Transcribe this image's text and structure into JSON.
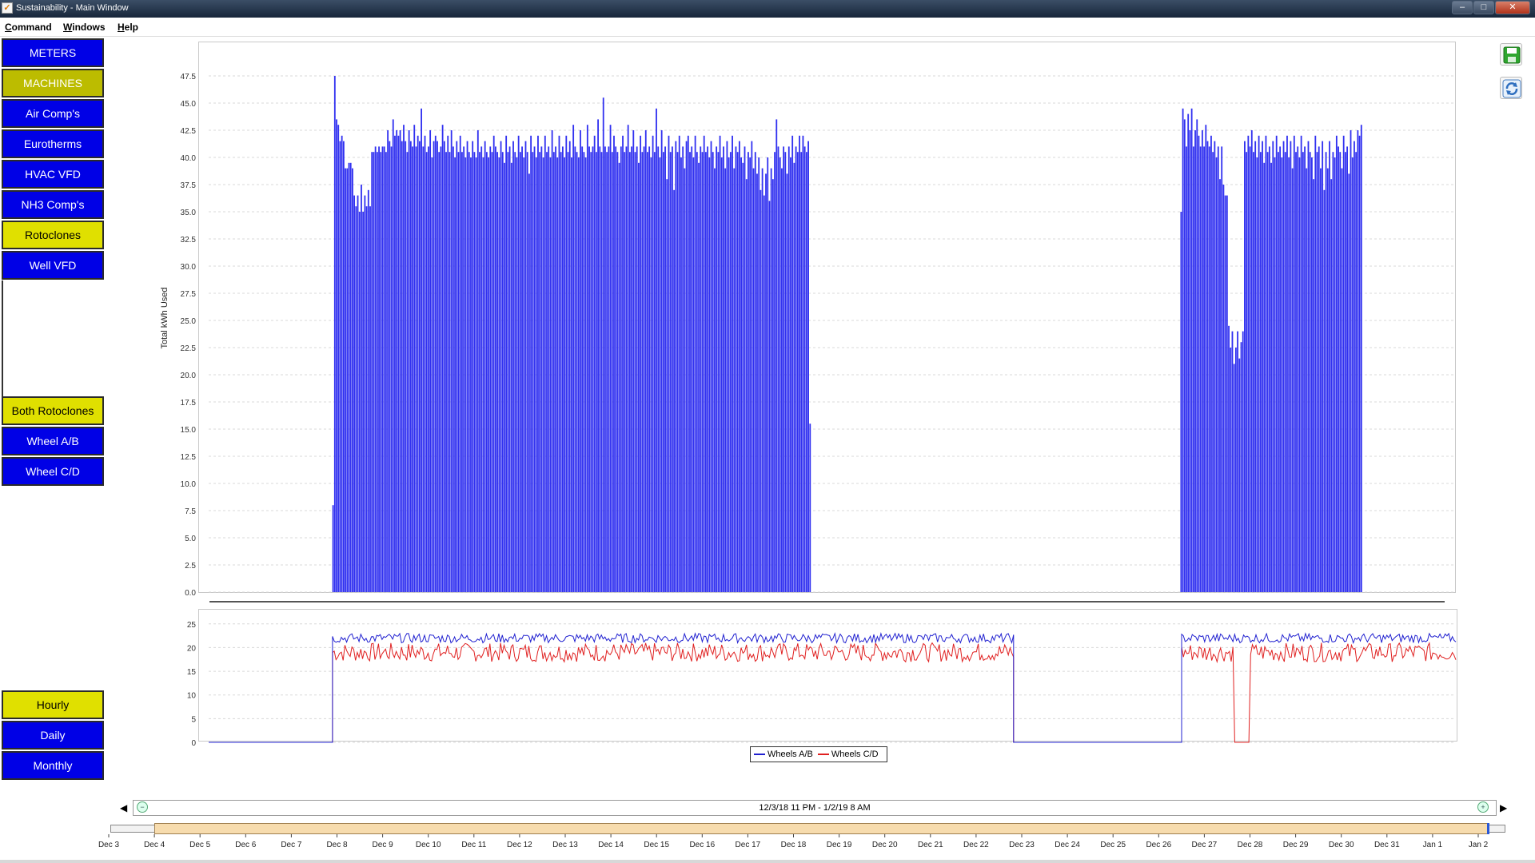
{
  "window": {
    "title": "Sustainability - Main Window",
    "icon": "check-icon",
    "min": "–",
    "max": "□",
    "close": "✕"
  },
  "menu": [
    {
      "label": "Command",
      "mnemonic": "C",
      "rest": "ommand"
    },
    {
      "label": "Windows",
      "mnemonic": "W",
      "rest": "indows"
    },
    {
      "label": "Help",
      "mnemonic": "H",
      "rest": "elp"
    }
  ],
  "sidebar": {
    "top": [
      {
        "label": "METERS",
        "style": "blue"
      },
      {
        "label": "MACHINES",
        "style": "olive"
      },
      {
        "label": "Air Comp's",
        "style": "blue"
      },
      {
        "label": "Eurotherms",
        "style": "blue"
      },
      {
        "label": "HVAC VFD",
        "style": "blue"
      },
      {
        "label": "NH3 Comp's",
        "style": "blue"
      },
      {
        "label": "Rotoclones",
        "style": "yellow"
      },
      {
        "label": "Well VFD",
        "style": "blue"
      }
    ],
    "middle": [
      {
        "label": "Both Rotoclones",
        "style": "yellow"
      },
      {
        "label": "Wheel A/B",
        "style": "blue"
      },
      {
        "label": "Wheel C/D",
        "style": "blue"
      }
    ],
    "bottom": [
      {
        "label": "Hourly",
        "style": "yellow"
      },
      {
        "label": "Daily",
        "style": "blue"
      },
      {
        "label": "Monthly",
        "style": "blue"
      }
    ]
  },
  "toolbar_icons": [
    "save-icon",
    "refresh-icon"
  ],
  "time_range": {
    "label": "12/3/18 11 PM - 1/2/19 8 AM",
    "left_arrow": "◀",
    "right_arrow": "▶",
    "zoom_out": "−",
    "zoom_in": "+"
  },
  "date_ticks": [
    "Dec 3",
    "Dec 4",
    "Dec 5",
    "Dec 6",
    "Dec 7",
    "Dec 8",
    "Dec 9",
    "Dec 10",
    "Dec 11",
    "Dec 12",
    "Dec 13",
    "Dec 14",
    "Dec 15",
    "Dec 16",
    "Dec 17",
    "Dec 18",
    "Dec 19",
    "Dec 20",
    "Dec 21",
    "Dec 22",
    "Dec 23",
    "Dec 24",
    "Dec 25",
    "Dec 26",
    "Dec 27",
    "Dec 28",
    "Dec 29",
    "Dec 30",
    "Dec 31",
    "Jan 1",
    "Jan 2"
  ],
  "legend": [
    {
      "label": "Wheels A/B",
      "color": "#2020d0"
    },
    {
      "label": "Wheels C/D",
      "color": "#e02020"
    }
  ],
  "chart_data": [
    {
      "type": "bar",
      "ylabel": "Total kWh Used",
      "ylim": [
        0,
        50
      ],
      "yticks": [
        "0.0",
        "2.5",
        "5.0",
        "7.5",
        "10.0",
        "12.5",
        "15.0",
        "17.5",
        "20.0",
        "22.5",
        "25.0",
        "27.5",
        "30.0",
        "32.5",
        "35.0",
        "37.5",
        "40.0",
        "42.5",
        "45.0",
        "47.5"
      ],
      "xlim": [
        "12/3/18 11 PM",
        "1/2/19 8 AM"
      ],
      "grid": true,
      "color": "#3030f0",
      "series": [
        {
          "segments": [
            {
              "start": "12/6/18 9 PM",
              "values": [
                8,
                47.5,
                43.5,
                43,
                41.5,
                42,
                41.5,
                39,
                39,
                39.5,
                39.5,
                39,
                36.5,
                35.5,
                36.5,
                35,
                37.5,
                35,
                36.5,
                35.5,
                37,
                35.5,
                40.5,
                40.5,
                41,
                40.5,
                41,
                40.5,
                41,
                41,
                40.5,
                42.5,
                41.5,
                41,
                43.5,
                42,
                42.5,
                42,
                42.5,
                41.5,
                43,
                41.5,
                40.5,
                42.5,
                41.5,
                41,
                43,
                41,
                42,
                41.5,
                44.5,
                41,
                42,
                40.5,
                41,
                42.5,
                40,
                41.5,
                42,
                41.5,
                40.5,
                41,
                43,
                41.5,
                40.5,
                42,
                40.5,
                42.5,
                41,
                40,
                41.5,
                40.5,
                42,
                40.5,
                41,
                40,
                41.5,
                40.5,
                40,
                41.5,
                40.5,
                40,
                42.5,
                40.5,
                41,
                40,
                41.5,
                40.5,
                40,
                41,
                40.5,
                42,
                41,
                40.5,
                40,
                41.5,
                40.5,
                39.5,
                42,
                40.5,
                41,
                39.5,
                41.5,
                40.5,
                40,
                42,
                40.5,
                41,
                40,
                41.5,
                40.5,
                38.5,
                42,
                40.5,
                41,
                40,
                42,
                40.5,
                41,
                40,
                42,
                40.5,
                41,
                40,
                42.5,
                40.5,
                41,
                40,
                42,
                40.5,
                41,
                40,
                42,
                40.5,
                41.5,
                40,
                43,
                41,
                40.5,
                40,
                42.5,
                41,
                40.5,
                40,
                43,
                41,
                40.5,
                41,
                42,
                40.5,
                43.5,
                41,
                40.5,
                45.5,
                41,
                40.5,
                41,
                43,
                40.5,
                42,
                41,
                40.5,
                39.5,
                41,
                42,
                40.5,
                41,
                43,
                40.5,
                41,
                42.5,
                40.5,
                41,
                39.5,
                42,
                40.5,
                41,
                42.5,
                40.5,
                41,
                40,
                42,
                40.5,
                44.5,
                41,
                40,
                42.5,
                40.5,
                41,
                38,
                42,
                40.5,
                41,
                37,
                41.5,
                40.5,
                42,
                40,
                41,
                39,
                41.5,
                42,
                40.5,
                41,
                40,
                42,
                40.5,
                39.5,
                41,
                40.5,
                42,
                40.5,
                41,
                40,
                41.5,
                40.5,
                39,
                41,
                40.5,
                42,
                40,
                41,
                39,
                41.5,
                40,
                40.5,
                42,
                39,
                41,
                40.5,
                41.5,
                40,
                39.5,
                41,
                38,
                40.5,
                40,
                41.5,
                39,
                40.5,
                38.5,
                40,
                37,
                39,
                36.5,
                38.5,
                40,
                36,
                39,
                38,
                40.5,
                43.5,
                41,
                40,
                39,
                41,
                40.5,
                38.5,
                41,
                40,
                42,
                39.5,
                41,
                40.5,
                42,
                40.5,
                42,
                41,
                40.5,
                41.5,
                15.5
              ]
            },
            {
              "start": "12/26/18 9 PM",
              "values": [
                35,
                44.5,
                43.5,
                41,
                44,
                42.5,
                44.5,
                41,
                42.5,
                43.5,
                42,
                41,
                42.5,
                41,
                43,
                41.5,
                41,
                42,
                40.5,
                41.5,
                40,
                41,
                38,
                41,
                37.5,
                36.5,
                36.5,
                24.5,
                22.5,
                24,
                21,
                22.5,
                24,
                21.5,
                23,
                24,
                41.5,
                40.5,
                42,
                41,
                42.5,
                40.5,
                41.5,
                40,
                42,
                40.5,
                41.5,
                39.5,
                42,
                40.5,
                41,
                39.5,
                41.5,
                40,
                42,
                40.5,
                41,
                40,
                41.5,
                40.5,
                42,
                40,
                41.5,
                39,
                42,
                40.5,
                41,
                40,
                42,
                40.5,
                41,
                39,
                41.5,
                40.5,
                40,
                38,
                42,
                40.5,
                41,
                39,
                41.5,
                37,
                40.5,
                39,
                41.5,
                38,
                40.5,
                40,
                42,
                41,
                40.5,
                39,
                42,
                40.5,
                41,
                38.5,
                42.5,
                40,
                41.5,
                40.5,
                42.5,
                42,
                43
              ]
            }
          ]
        }
      ]
    },
    {
      "type": "line",
      "ylim": [
        0,
        28
      ],
      "yticks": [
        "0",
        "5",
        "10",
        "15",
        "20",
        "25"
      ],
      "xlim": [
        "12/3/18 11 PM",
        "1/2/19 8 AM"
      ],
      "grid": true,
      "series": [
        {
          "name": "Wheels A/B",
          "color": "#2020d0"
        },
        {
          "name": "Wheels C/D",
          "color": "#e02020"
        }
      ],
      "segments": [
        {
          "from": "12/3/18 11 PM",
          "to": "12/6/18 9 PM",
          "ab": 0,
          "cd": 0
        },
        {
          "from": "12/6/18 9 PM",
          "to": "12/22/18 10 PM",
          "ab_approx": 22,
          "cd_approx": 19
        },
        {
          "from": "12/22/18 10 PM",
          "to": "12/26/18 9 PM",
          "ab": 0,
          "cd": 0
        },
        {
          "from": "12/26/18 9 PM",
          "to": "1/2/19 8 AM",
          "ab_approx": 22,
          "cd_approx": 19
        }
      ],
      "cd_drop": {
        "from": "12/28/18 3 AM",
        "to": "12/28/18 11 AM",
        "value": 0
      }
    }
  ]
}
